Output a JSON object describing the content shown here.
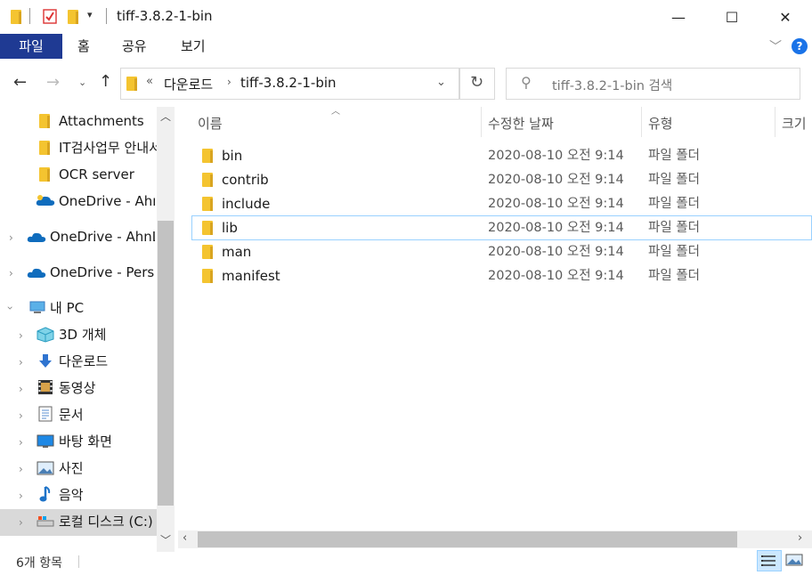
{
  "window": {
    "title": "tiff-3.8.2-1-bin",
    "minimize_glyph": "—",
    "maximize_glyph": "☐",
    "close_glyph": "✕"
  },
  "ribbon": {
    "tabs": [
      {
        "label": "파일",
        "active": true
      },
      {
        "label": "홈"
      },
      {
        "label": "공유"
      },
      {
        "label": "보기"
      }
    ],
    "help_glyph": "?"
  },
  "address": {
    "overflow": "«",
    "crumbs": [
      "다운로드",
      "tiff-3.8.2-1-bin"
    ],
    "search_placeholder": "tiff-3.8.2-1-bin 검색"
  },
  "nav": {
    "items": [
      {
        "label": "Attachments",
        "icon": "folder-icon"
      },
      {
        "label": "IT검사업무 안내서",
        "icon": "folder-icon"
      },
      {
        "label": "OCR server",
        "icon": "folder-icon"
      },
      {
        "label": "OneDrive - Ahn",
        "icon": "onedrive-icon"
      },
      {
        "label": "OneDrive - AhnLab",
        "icon": "onedrive-icon"
      },
      {
        "label": "OneDrive - Personal",
        "icon": "onedrive-icon"
      },
      {
        "label": "내 PC",
        "icon": "pc-icon"
      },
      {
        "label": "3D 개체",
        "icon": "3d-objects-icon"
      },
      {
        "label": "다운로드",
        "icon": "download-icon"
      },
      {
        "label": "동영상",
        "icon": "video-icon"
      },
      {
        "label": "문서",
        "icon": "document-icon"
      },
      {
        "label": "바탕 화면",
        "icon": "desktop-icon"
      },
      {
        "label": "사진",
        "icon": "picture-icon"
      },
      {
        "label": "음악",
        "icon": "music-icon"
      },
      {
        "label": "로컬 디스크 (C:)",
        "icon": "drive-icon"
      }
    ]
  },
  "columns": {
    "name": "이름",
    "date": "수정한 날짜",
    "type": "유형",
    "size": "크기"
  },
  "files": [
    {
      "name": "bin",
      "date": "2020-08-10 오전 9:14",
      "type": "파일 폴더"
    },
    {
      "name": "contrib",
      "date": "2020-08-10 오전 9:14",
      "type": "파일 폴더"
    },
    {
      "name": "include",
      "date": "2020-08-10 오전 9:14",
      "type": "파일 폴더"
    },
    {
      "name": "lib",
      "date": "2020-08-10 오전 9:14",
      "type": "파일 폴더",
      "selected": true
    },
    {
      "name": "man",
      "date": "2020-08-10 오전 9:14",
      "type": "파일 폴더"
    },
    {
      "name": "manifest",
      "date": "2020-08-10 오전 9:14",
      "type": "파일 폴더"
    }
  ],
  "status": {
    "count": "6개 항목"
  },
  "colors": {
    "accent": "#1f3a93",
    "help": "#1a73e8",
    "selection_border": "#99d1ff"
  }
}
